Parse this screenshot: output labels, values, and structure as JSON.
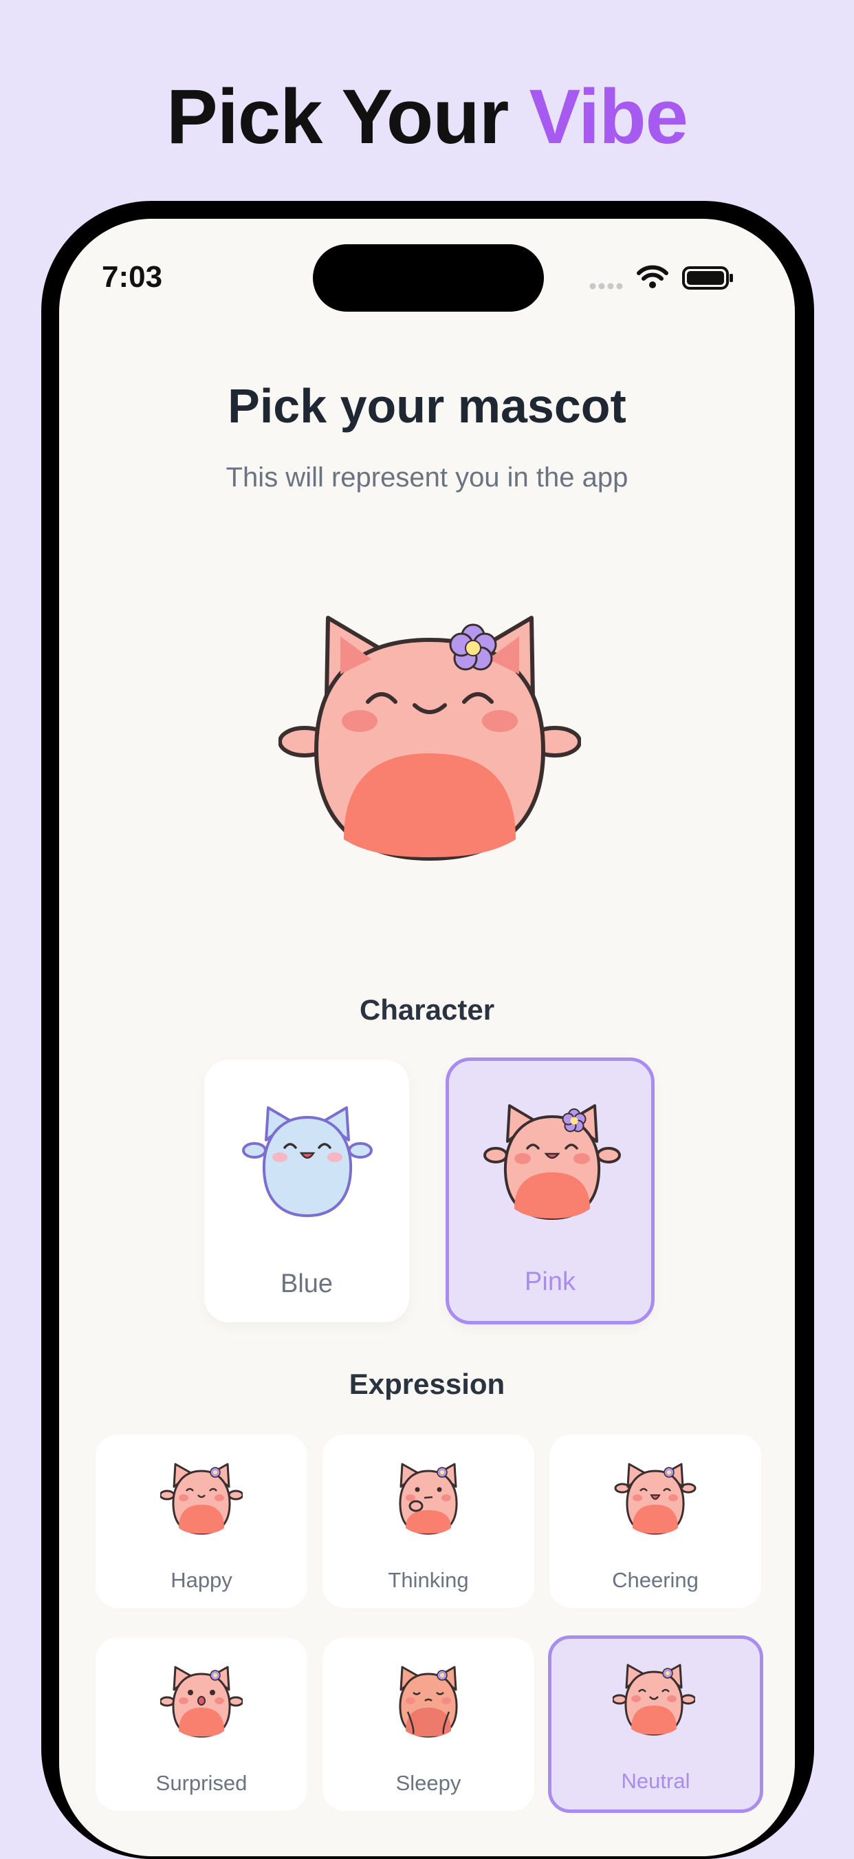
{
  "headline": {
    "prefix": "Pick Your ",
    "accent": "Vibe"
  },
  "status_bar": {
    "time": "7:03"
  },
  "header": {
    "title": "Pick your mascot",
    "subtitle": "This will represent you in the app"
  },
  "character": {
    "label": "Character",
    "options": [
      {
        "label": "Blue",
        "selected": false
      },
      {
        "label": "Pink",
        "selected": true
      }
    ]
  },
  "expression": {
    "label": "Expression",
    "options": [
      {
        "label": "Happy",
        "selected": false
      },
      {
        "label": "Thinking",
        "selected": false
      },
      {
        "label": "Cheering",
        "selected": false
      },
      {
        "label": "Surprised",
        "selected": false
      },
      {
        "label": "Sleepy",
        "selected": false
      },
      {
        "label": "Neutral",
        "selected": true
      }
    ]
  },
  "colors": {
    "background": "#e8e2fb",
    "accent": "#a65af0",
    "selection": "#a98cf0",
    "mascot_pink": "#f8b6ad",
    "mascot_belly": "#f9806f",
    "mascot_blue": "#cfe3f7"
  }
}
